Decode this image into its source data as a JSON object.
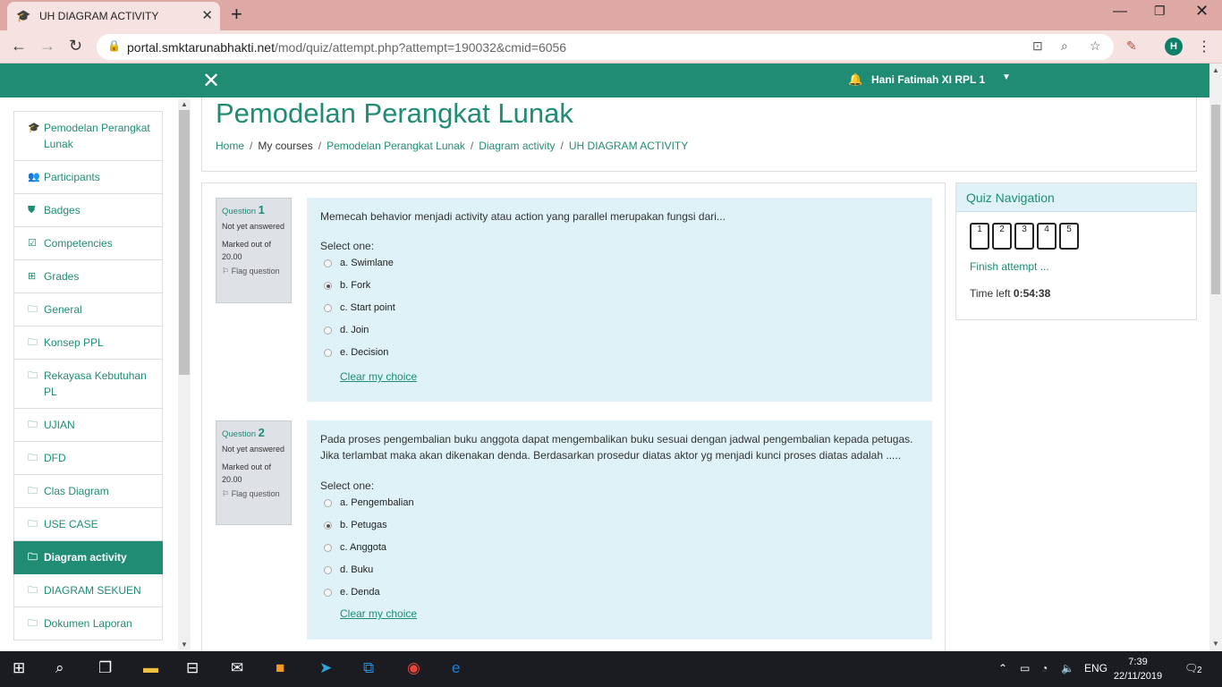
{
  "browser": {
    "tab_title": "UH DIAGRAM ACTIVITY",
    "url_host": "portal.smktarunabhakti.net",
    "url_path": "/mod/quiz/attempt.php?attempt=190032&cmid=6056",
    "profile_initial": "H"
  },
  "navbar": {
    "user_name": "Hani Fatimah XI RPL 1"
  },
  "sidebar": {
    "items": [
      {
        "label": "Pemodelan Perangkat Lunak",
        "icon": "graduation-cap-icon",
        "glyph": "🎓"
      },
      {
        "label": "Participants",
        "icon": "users-icon",
        "glyph": "👥"
      },
      {
        "label": "Badges",
        "icon": "shield-icon",
        "glyph": "⛊"
      },
      {
        "label": "Competencies",
        "icon": "check-square-icon",
        "glyph": "☑"
      },
      {
        "label": "Grades",
        "icon": "table-icon",
        "glyph": "⊞"
      },
      {
        "label": "General",
        "icon": "folder-icon",
        "glyph": "🗀"
      },
      {
        "label": "Konsep PPL",
        "icon": "folder-icon",
        "glyph": "🗀"
      },
      {
        "label": "Rekayasa Kebutuhan PL",
        "icon": "folder-icon",
        "glyph": "🗀"
      },
      {
        "label": "UJIAN",
        "icon": "folder-icon",
        "glyph": "🗀"
      },
      {
        "label": "DFD",
        "icon": "folder-icon",
        "glyph": "🗀"
      },
      {
        "label": "Clas Diagram",
        "icon": "folder-icon",
        "glyph": "🗀"
      },
      {
        "label": "USE CASE",
        "icon": "folder-icon",
        "glyph": "🗀"
      },
      {
        "label": "Diagram activity",
        "icon": "folder-icon",
        "glyph": "🗀",
        "active": true
      },
      {
        "label": "DIAGRAM SEKUEN",
        "icon": "folder-icon",
        "glyph": "🗀"
      },
      {
        "label": "Dokumen Laporan",
        "icon": "folder-icon",
        "glyph": "🗀"
      }
    ]
  },
  "header": {
    "title": "Pemodelan Perangkat Lunak",
    "breadcrumb": [
      "Home",
      "My courses",
      "Pemodelan Perangkat Lunak",
      "Diagram activity",
      "UH DIAGRAM ACTIVITY"
    ]
  },
  "questions": [
    {
      "label": "Question",
      "number": "1",
      "state": "Not yet answered",
      "marks": "Marked out of 20.00",
      "flag": "Flag question",
      "text": "Memecah behavior menjadi activity atau action yang parallel merupakan fungsi dari...",
      "select_label": "Select one:",
      "options": [
        "a. Swimlane",
        "b. Fork",
        "c. Start point",
        "d. Join",
        "e. Decision"
      ],
      "selected_index": 1,
      "clear": "Clear my choice"
    },
    {
      "label": "Question",
      "number": "2",
      "state": "Not yet answered",
      "marks": "Marked out of 20.00",
      "flag": "Flag question",
      "text": "Pada proses pengembalian buku anggota dapat mengembalikan buku sesuai dengan jadwal pengembalian kepada petugas. Jika terlambat maka akan dikenakan denda. Berdasarkan prosedur diatas aktor yg menjadi kunci proses diatas adalah .....",
      "select_label": "Select one:",
      "options": [
        "a. Pengembalian",
        "b. Petugas",
        "c. Anggota",
        "d. Buku",
        "e. Denda"
      ],
      "selected_index": 1,
      "clear": "Clear my choice"
    }
  ],
  "quiz_nav": {
    "title": "Quiz Navigation",
    "buttons": [
      "1",
      "2",
      "3",
      "4",
      "5"
    ],
    "finish": "Finish attempt ...",
    "time_label": "Time left",
    "time_value": "0:54:38"
  },
  "taskbar": {
    "language": "ENG",
    "time": "7:39",
    "date": "22/11/2019",
    "notifications": "2"
  },
  "colors": {
    "brand": "#218c74",
    "tab_strip": "#dea8a5",
    "question_bg": "#def2f8"
  }
}
